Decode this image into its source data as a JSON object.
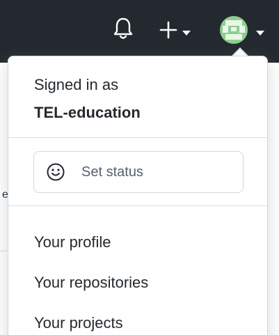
{
  "header": {
    "icons": {
      "notifications": "bell-icon",
      "create_new": "plus-icon",
      "caret": "caret-down-icon",
      "avatar": "identicon-avatar"
    },
    "colors": {
      "background": "#24292f",
      "icon": "#ffffff",
      "avatar": "#8ccf8c"
    }
  },
  "menu": {
    "signed_in_label": "Signed in as",
    "username": "TEL-education",
    "status_button": {
      "label": "Set status",
      "icon": "smiley-icon"
    },
    "items": [
      {
        "label": "Your profile"
      },
      {
        "label": "Your repositories"
      },
      {
        "label": "Your projects"
      }
    ]
  },
  "background": {
    "partial_char": "e"
  }
}
